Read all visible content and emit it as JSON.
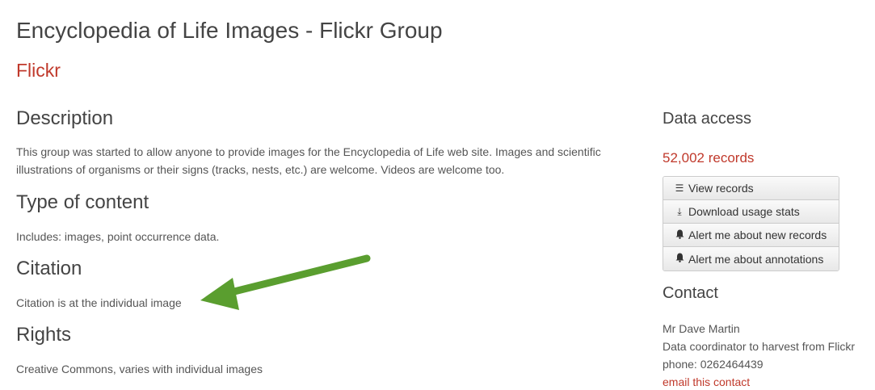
{
  "page": {
    "title": "Encyclopedia of Life Images - Flickr Group",
    "provider": "Flickr"
  },
  "sections": {
    "description": {
      "heading": "Description",
      "text": "This group was started to allow anyone to provide images for the Encyclopedia of Life web site. Images and scientific illustrations of organisms or their signs (tracks, nests, etc.) are welcome. Videos are welcome too."
    },
    "content_type": {
      "heading": "Type of content",
      "text": "Includes: images, point occurrence data."
    },
    "citation": {
      "heading": "Citation",
      "text": "Citation is at the individual image"
    },
    "rights": {
      "heading": "Rights",
      "text": "Creative Commons, varies with individual images"
    }
  },
  "sidebar": {
    "data_access": {
      "heading": "Data access",
      "records": "52,002 records",
      "buttons": [
        {
          "label": "View records",
          "icon": "list-icon"
        },
        {
          "label": "Download usage stats",
          "icon": "download-icon"
        },
        {
          "label": "Alert me about new records",
          "icon": "bell-icon"
        },
        {
          "label": "Alert me about annotations",
          "icon": "bell-icon"
        }
      ]
    },
    "contact": {
      "heading": "Contact",
      "name": "Mr Dave Martin",
      "role": "Data coordinator to harvest from Flickr",
      "phone": "phone: 0262464439",
      "email_label": "email this contact"
    }
  },
  "annotation": {
    "arrow_color": "#5a9e2f"
  }
}
